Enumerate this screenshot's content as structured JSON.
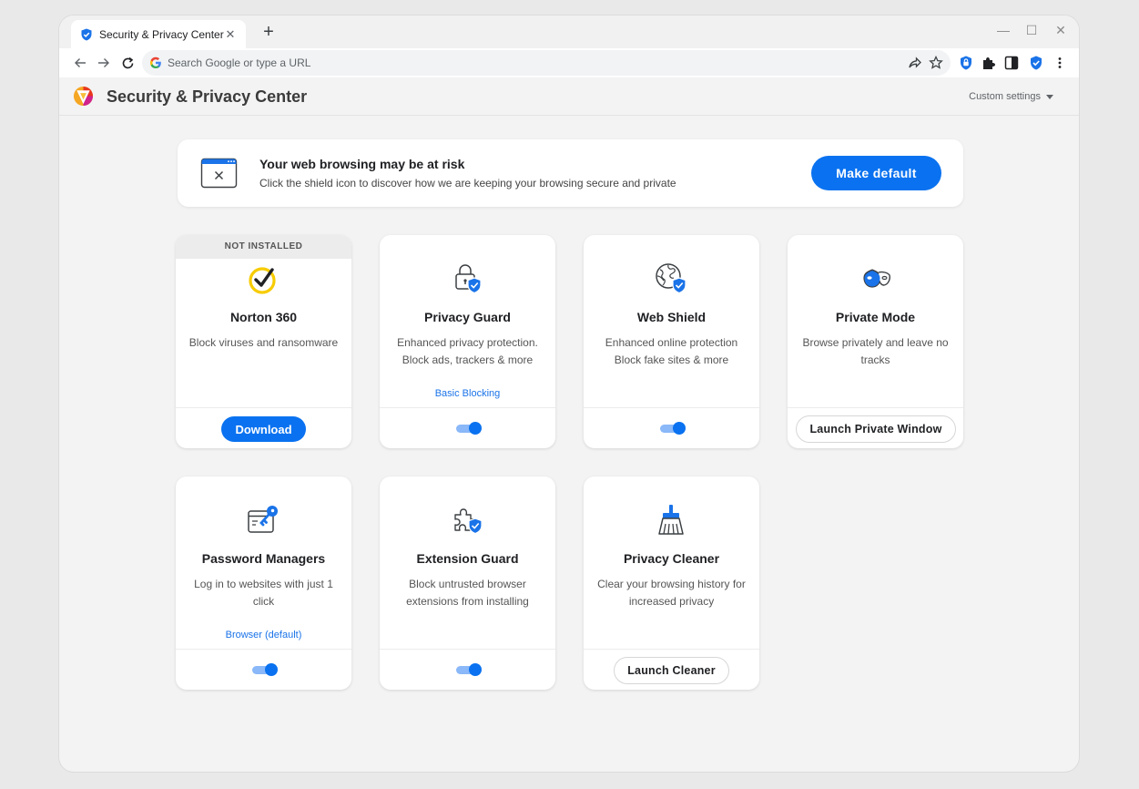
{
  "browser": {
    "tab_title": "Security & Privacy Center",
    "tab_close": "✕",
    "new_tab": "+",
    "omnibox_placeholder": "Search Google or type a URL",
    "minimize": "—",
    "maximize": "☐",
    "close": "✕"
  },
  "header": {
    "title": "Security & Privacy Center",
    "settings_label": "Custom settings"
  },
  "banner": {
    "heading": "Your web browsing may be at risk",
    "subtext": "Click the shield icon to discover how we are keeping your browsing secure and private",
    "button": "Make default"
  },
  "cards": [
    {
      "ribbon": "NOT INSTALLED",
      "title": "Norton 360",
      "desc": "Block viruses and ransomware",
      "action": "Download",
      "icon": "norton-check-icon"
    },
    {
      "title": "Privacy Guard",
      "desc": "Enhanced privacy protection. Block ads, trackers & more",
      "link": "Basic Blocking",
      "toggle_on": true,
      "icon": "lock-shield-icon"
    },
    {
      "title": "Web Shield",
      "desc": "Enhanced online protection Block fake sites & more",
      "toggle_on": true,
      "icon": "globe-shield-icon"
    },
    {
      "title": "Private Mode",
      "desc": "Browse privately and leave no tracks",
      "action": "Launch Private Window",
      "icon": "mask-icon"
    },
    {
      "title": "Password Managers",
      "desc": "Log in to websites with just 1 click",
      "link": "Browser (default)",
      "toggle_on": true,
      "icon": "key-window-icon"
    },
    {
      "title": "Extension Guard",
      "desc": "Block untrusted browser extensions from installing",
      "toggle_on": true,
      "icon": "puzzle-shield-icon"
    },
    {
      "title": "Privacy Cleaner",
      "desc": "Clear your browsing history for increased privacy",
      "action": "Launch Cleaner",
      "icon": "broom-icon"
    }
  ],
  "colors": {
    "accent": "#0a72f0",
    "toggle_track": "#8ab8f8",
    "background": "#f3f3f3"
  }
}
